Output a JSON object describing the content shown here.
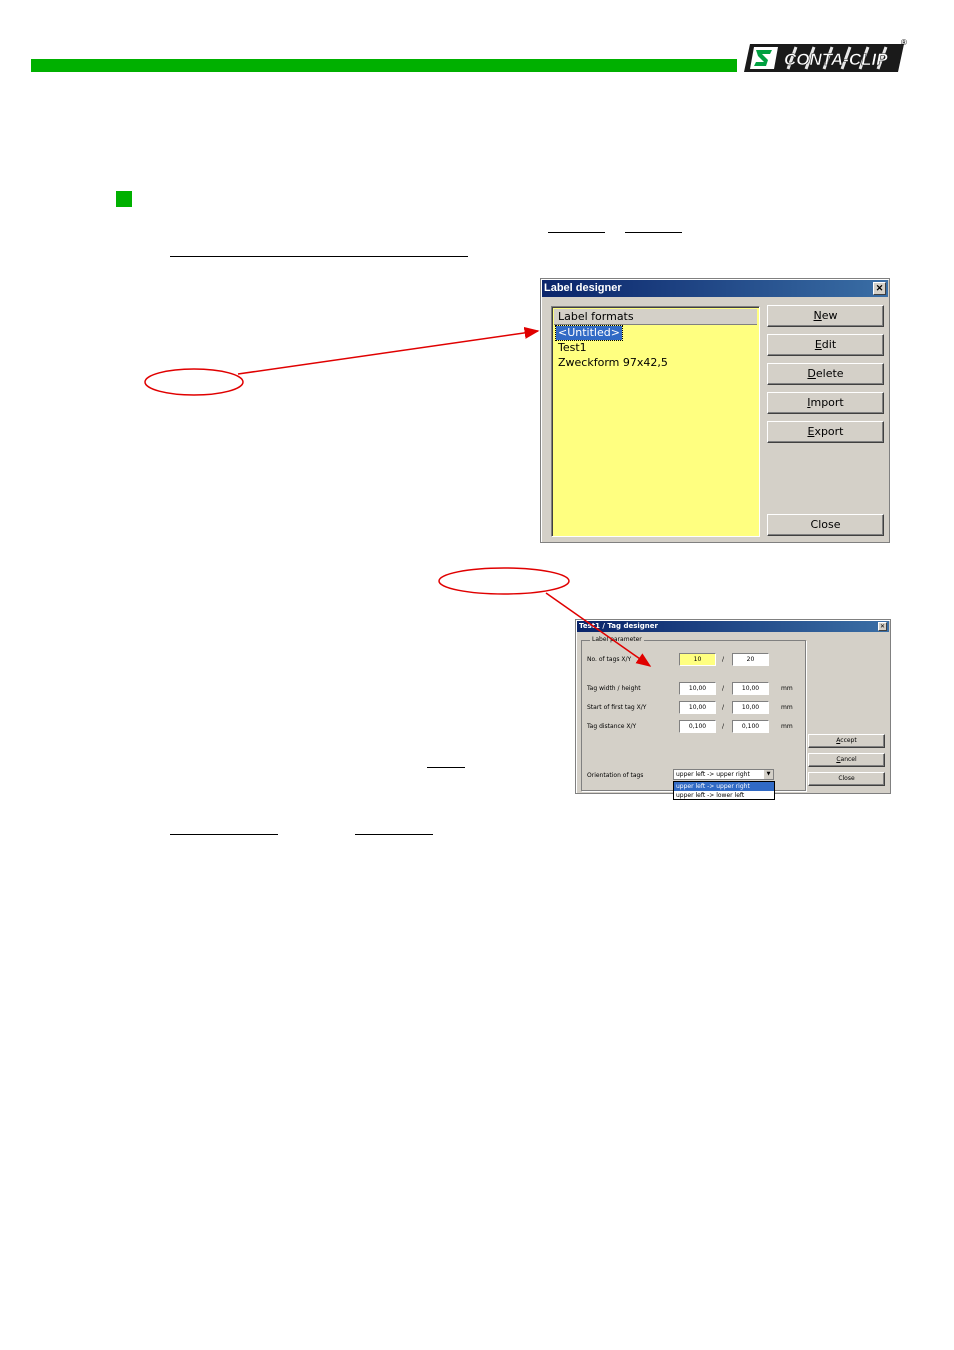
{
  "header": {
    "brand": "CONTA-CLIP",
    "registered": "®",
    "colors": {
      "bar": "#00b000",
      "logo_dark": "#1a1a1a"
    }
  },
  "label_designer": {
    "title": "Label designer",
    "list_header": "Label formats",
    "items": [
      "<Untitled>",
      "Test1",
      "Zweckform 97x42,5"
    ],
    "selected_index": 0,
    "buttons": [
      {
        "mnemonic": "N",
        "rest": "ew"
      },
      {
        "mnemonic": "E",
        "rest": "dit"
      },
      {
        "mnemonic": "D",
        "rest": "elete"
      },
      {
        "mnemonic": "I",
        "rest": "mport"
      },
      {
        "mnemonic": "E",
        "rest": "xport"
      }
    ],
    "close_label": "Close",
    "list_color": "#ffff80"
  },
  "tag_designer": {
    "title": "Test1 / Tag designer",
    "group_title": "Label parameter",
    "rows": [
      {
        "label": "No. of tags X/Y",
        "x": "10",
        "y": "20",
        "unit": ""
      },
      {
        "label": "Tag width / height",
        "x": "10,00",
        "y": "10,00",
        "unit": "mm"
      },
      {
        "label": "Start of first tag X/Y",
        "x": "10,00",
        "y": "10,00",
        "unit": "mm"
      },
      {
        "label": "Tag distance X/Y",
        "x": "0,100",
        "y": "0,100",
        "unit": "mm"
      }
    ],
    "separator": "/",
    "orientation_label": "Orientation of tags",
    "orientation_value": "upper left -> upper right",
    "orientation_options": [
      "upper left -> upper right",
      "upper left -> lower left"
    ],
    "buttons": [
      {
        "mnemonic": "A",
        "rest": "ccept"
      },
      {
        "mnemonic": "C",
        "rest": "ancel"
      }
    ],
    "close_label": "Close"
  },
  "annotation_color": "#e00000"
}
